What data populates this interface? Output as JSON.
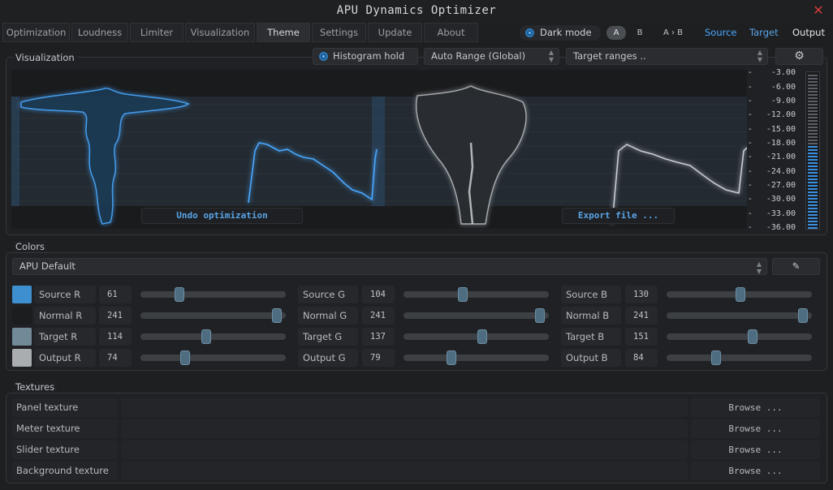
{
  "app_title": "APU Dynamics Optimizer",
  "tabs": [
    "Optimization",
    "Loudness",
    "Limiter",
    "Visualization",
    "Theme",
    "Settings",
    "Update",
    "About"
  ],
  "active_tab": "Theme",
  "dark_mode": {
    "label": "Dark mode",
    "on": true
  },
  "ab": {
    "a": "A",
    "b": "B",
    "a_to_b": "A › B"
  },
  "views": {
    "source": "Source",
    "target": "Target",
    "output": "Output",
    "source_color": "#4aa8ff"
  },
  "visualization": {
    "title": "Visualization",
    "histogram_hold": {
      "label": "Histogram hold",
      "on": true
    },
    "range_select": "Auto Range (Global)",
    "target_select": "Target ranges ..",
    "undo_label": "Undo optimization",
    "export_label": "Export file ...",
    "scale": [
      "-3.00",
      "-6.00",
      "-9.00",
      "-12.00",
      "-15.00",
      "-18.00",
      "-21.00",
      "-24.00",
      "-27.00",
      "-30.00",
      "-33.00",
      "-36.00"
    ]
  },
  "colors": {
    "title": "Colors",
    "preset": "APU Default",
    "rows": [
      {
        "swatch": "#3d8fcf",
        "r_label": "Source R",
        "r": 61,
        "g_label": "Source G",
        "g": 104,
        "b_label": "Source B",
        "b": 130
      },
      {
        "swatch": "#1c1d1f",
        "r_label": "Normal R",
        "r": 241,
        "g_label": "Normal G",
        "g": 241,
        "b_label": "Normal B",
        "b": 241
      },
      {
        "swatch": "#728997",
        "r_label": "Target R",
        "r": 114,
        "g_label": "Target G",
        "g": 137,
        "b_label": "Target B",
        "b": 151
      },
      {
        "swatch": "#a9adb0",
        "r_label": "Output R",
        "r": 74,
        "g_label": "Output G",
        "g": 79,
        "b_label": "Output B",
        "b": 84
      }
    ]
  },
  "textures": {
    "title": "Textures",
    "browse_label": "Browse ...",
    "items": [
      "Panel texture",
      "Meter texture",
      "Slider texture",
      "Background texture"
    ]
  }
}
